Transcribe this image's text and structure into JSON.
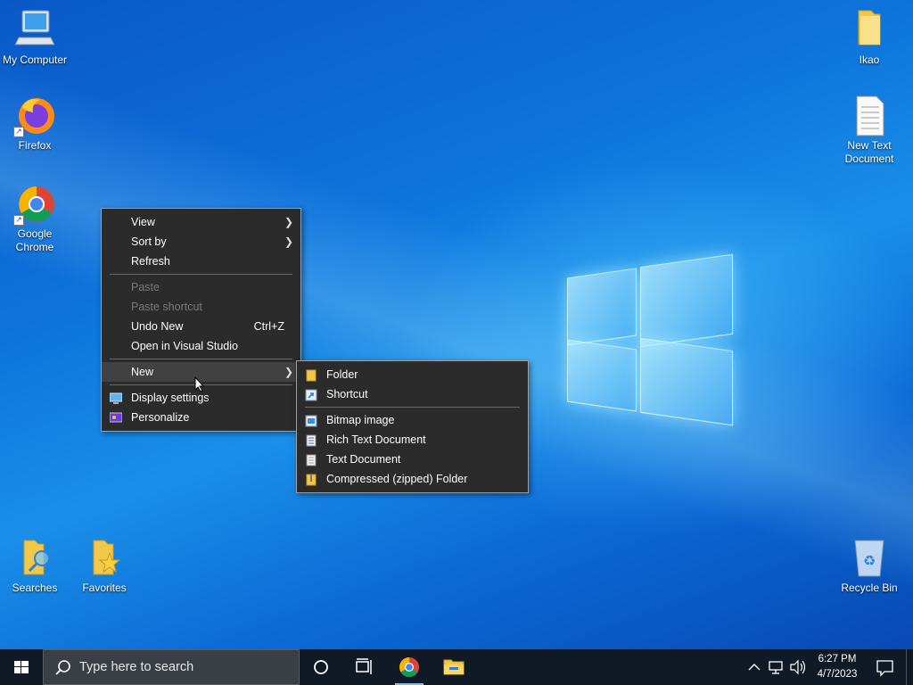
{
  "desktop_icons": {
    "my_computer": "My Computer",
    "firefox": "Firefox",
    "chrome": "Google Chrome",
    "ikao": "Ikao",
    "new_text_doc": "New Text Document",
    "searches": "Searches",
    "favorites": "Favorites",
    "recycle_bin": "Recycle Bin"
  },
  "context_menu": {
    "view": "View",
    "sort_by": "Sort by",
    "refresh": "Refresh",
    "paste": "Paste",
    "paste_shortcut": "Paste shortcut",
    "undo_new": "Undo New",
    "undo_shortcut": "Ctrl+Z",
    "open_vs": "Open in Visual Studio",
    "new": "New",
    "display_settings": "Display settings",
    "personalize": "Personalize"
  },
  "new_submenu": {
    "folder": "Folder",
    "shortcut": "Shortcut",
    "bitmap": "Bitmap image",
    "rtf": "Rich Text Document",
    "text": "Text Document",
    "zip": "Compressed (zipped) Folder"
  },
  "taskbar": {
    "search_placeholder": "Type here to search",
    "time": "6:27 PM",
    "date": "4/7/2023"
  },
  "colors": {
    "menu_bg": "#2b2b2b",
    "taskbar_bg": "#101a26",
    "desktop_blue": "#0d74dc"
  }
}
